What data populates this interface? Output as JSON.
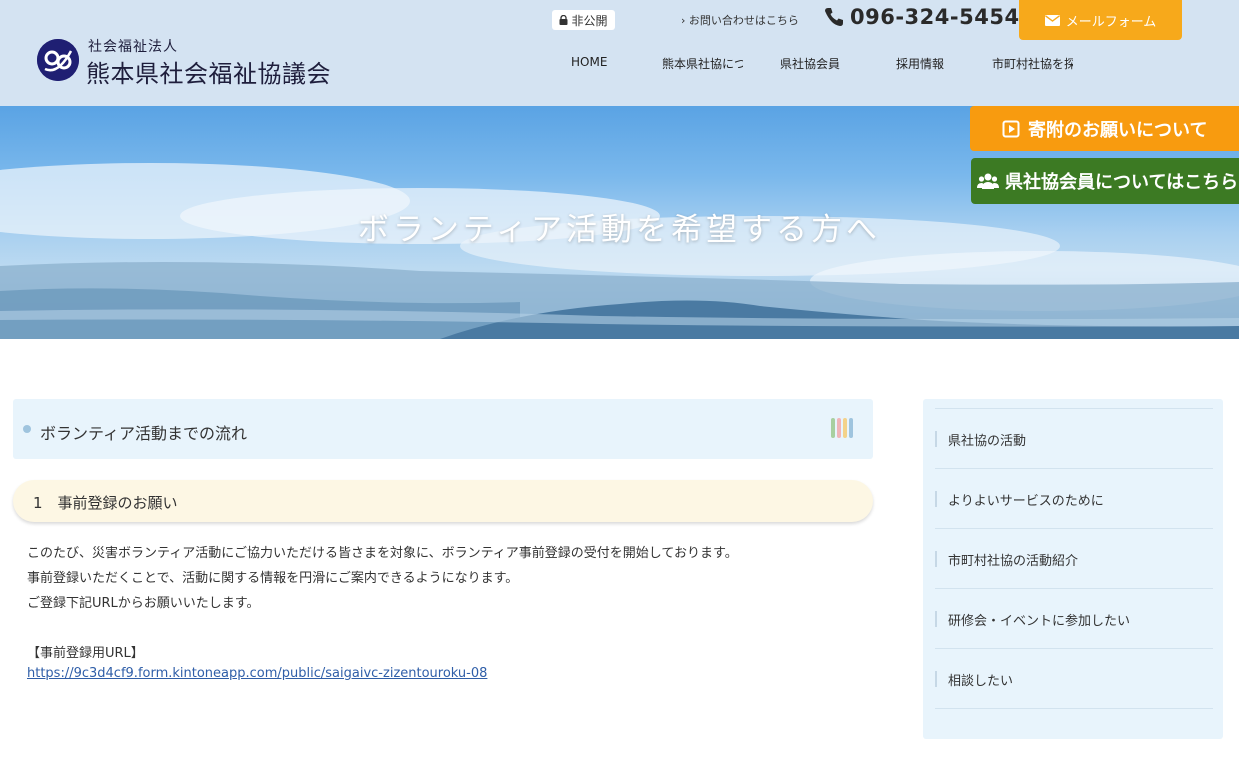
{
  "header": {
    "org_type": "社会福祉法人",
    "org_name": "熊本県社会福祉協議会",
    "private_badge": "非公開",
    "contact_link": "› お問い合わせはこちら",
    "phone": "096-324-5454",
    "mail_button": "メールフォーム"
  },
  "nav": {
    "items": [
      {
        "label": "HOME"
      },
      {
        "label": "熊本県社協について"
      },
      {
        "label": "県社協会員"
      },
      {
        "label": "採用情報"
      },
      {
        "label": "市町村社協を探す"
      }
    ]
  },
  "hero": {
    "title": "ボランティア活動を希望する方へ"
  },
  "floating_buttons": {
    "donate": "寄附のお願いについて",
    "member": "県社協会員についてはこちら"
  },
  "content": {
    "section_title": "ボランティア活動までの流れ",
    "sub_title": "1　事前登録のお願い",
    "paragraphs": [
      "このたび、災害ボランティア活動にご協力いただける皆さまを対象に、ボランティア事前登録の受付を開始しております。",
      "事前登録いただくことで、活動に関する情報を円滑にご案内できるようになります。",
      "ご登録下記URLからお願いいたします。",
      "",
      "【事前登録用URL】"
    ],
    "url": "https://9c3d4cf9.form.kintoneapp.com/public/saigaivc-zizentouroku-08"
  },
  "sidebar": {
    "items": [
      {
        "label": "県社協の活動"
      },
      {
        "label": "よりよいサービスのために"
      },
      {
        "label": "市町村社協の活動紹介"
      },
      {
        "label": "研修会・イベントに参加したい"
      },
      {
        "label": "相談したい"
      }
    ]
  },
  "colors": {
    "header_bg": "#d4e3f2",
    "mail_button": "#f7a91b",
    "donate_button": "#f89b0f",
    "member_button": "#3c7a23",
    "link": "#2f5ea8",
    "stripes": [
      "#a8cfa0",
      "#f0b4b8",
      "#f3d28a",
      "#9fc4de"
    ]
  }
}
